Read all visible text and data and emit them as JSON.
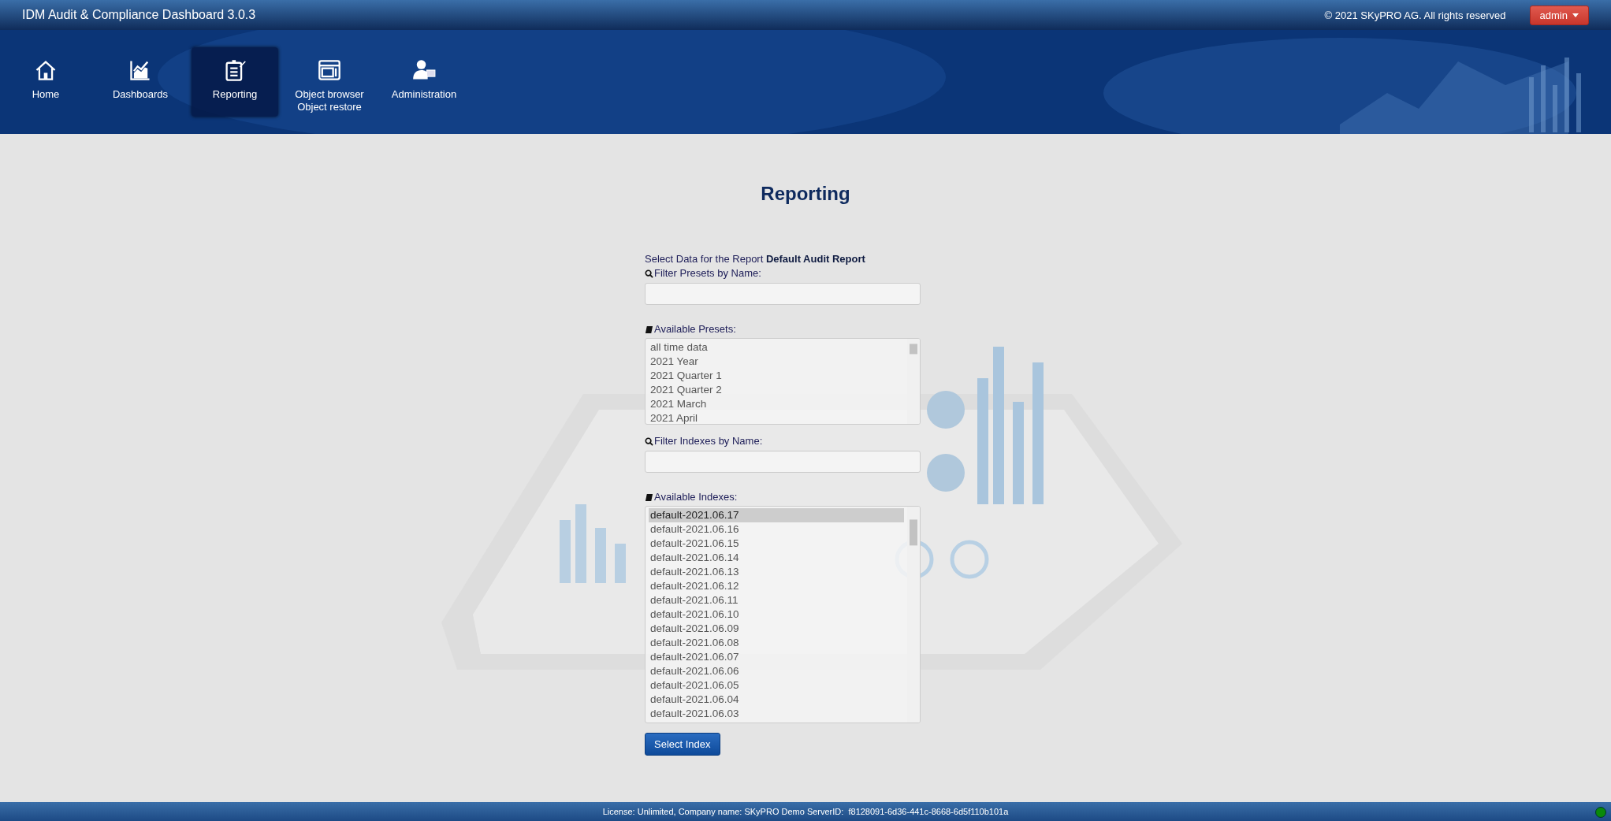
{
  "header": {
    "title": "IDM Audit & Compliance Dashboard 3.0.3",
    "copyright": "© 2021 SKyPRO AG. All rights reserved",
    "user_menu": "admin"
  },
  "nav": [
    {
      "kind": "home",
      "label": "Home",
      "selected": false
    },
    {
      "kind": "dashboards",
      "label": "Dashboards",
      "selected": false
    },
    {
      "kind": "reporting",
      "label": "Reporting",
      "selected": true
    },
    {
      "kind": "browser",
      "label": "Object browser\nObject restore",
      "selected": false
    },
    {
      "kind": "admin",
      "label": "Administration",
      "selected": false
    }
  ],
  "page_title": "Reporting",
  "form": {
    "intro": "Select Data for the Report **Default Audit Report**",
    "preset_filter": {
      "label": "Filter Presets by Name:"
    },
    "presets": {
      "label": "Available Presets:",
      "items": [
        {
          "label": "all time data",
          "selected": false
        },
        {
          "label": "2021 Year",
          "selected": false
        },
        {
          "label": "2021 Quarter 1",
          "selected": false
        },
        {
          "label": "2021 Quarter 2",
          "selected": false
        },
        {
          "label": "2021 March",
          "selected": false
        },
        {
          "label": "2021 April",
          "selected": false
        }
      ]
    },
    "index_filter": {
      "label": "Filter Indexes by Name:"
    },
    "indexes": {
      "label": "Available Indexes:",
      "items": [
        {
          "label": "default-2021.06.17",
          "selected": true
        },
        {
          "label": "default-2021.06.16",
          "selected": false
        },
        {
          "label": "default-2021.06.15",
          "selected": false
        },
        {
          "label": "default-2021.06.14",
          "selected": false
        },
        {
          "label": "default-2021.06.13",
          "selected": false
        },
        {
          "label": "default-2021.06.12",
          "selected": false
        },
        {
          "label": "default-2021.06.11",
          "selected": false
        },
        {
          "label": "default-2021.06.10",
          "selected": false
        },
        {
          "label": "default-2021.06.09",
          "selected": false
        },
        {
          "label": "default-2021.06.08",
          "selected": false
        },
        {
          "label": "default-2021.06.07",
          "selected": false
        },
        {
          "label": "default-2021.06.06",
          "selected": false
        },
        {
          "label": "default-2021.06.05",
          "selected": false
        },
        {
          "label": "default-2021.06.04",
          "selected": false
        },
        {
          "label": "default-2021.06.03",
          "selected": false
        }
      ]
    },
    "submit": "Select Index"
  },
  "footer": {
    "text": "License: Unlimited, Company name: SKyPRO Demo ServerID:  f8128091-6d36-441c-8668-6d5f110b101a",
    "status_light": {
      "color": "#0a8a0a"
    }
  }
}
